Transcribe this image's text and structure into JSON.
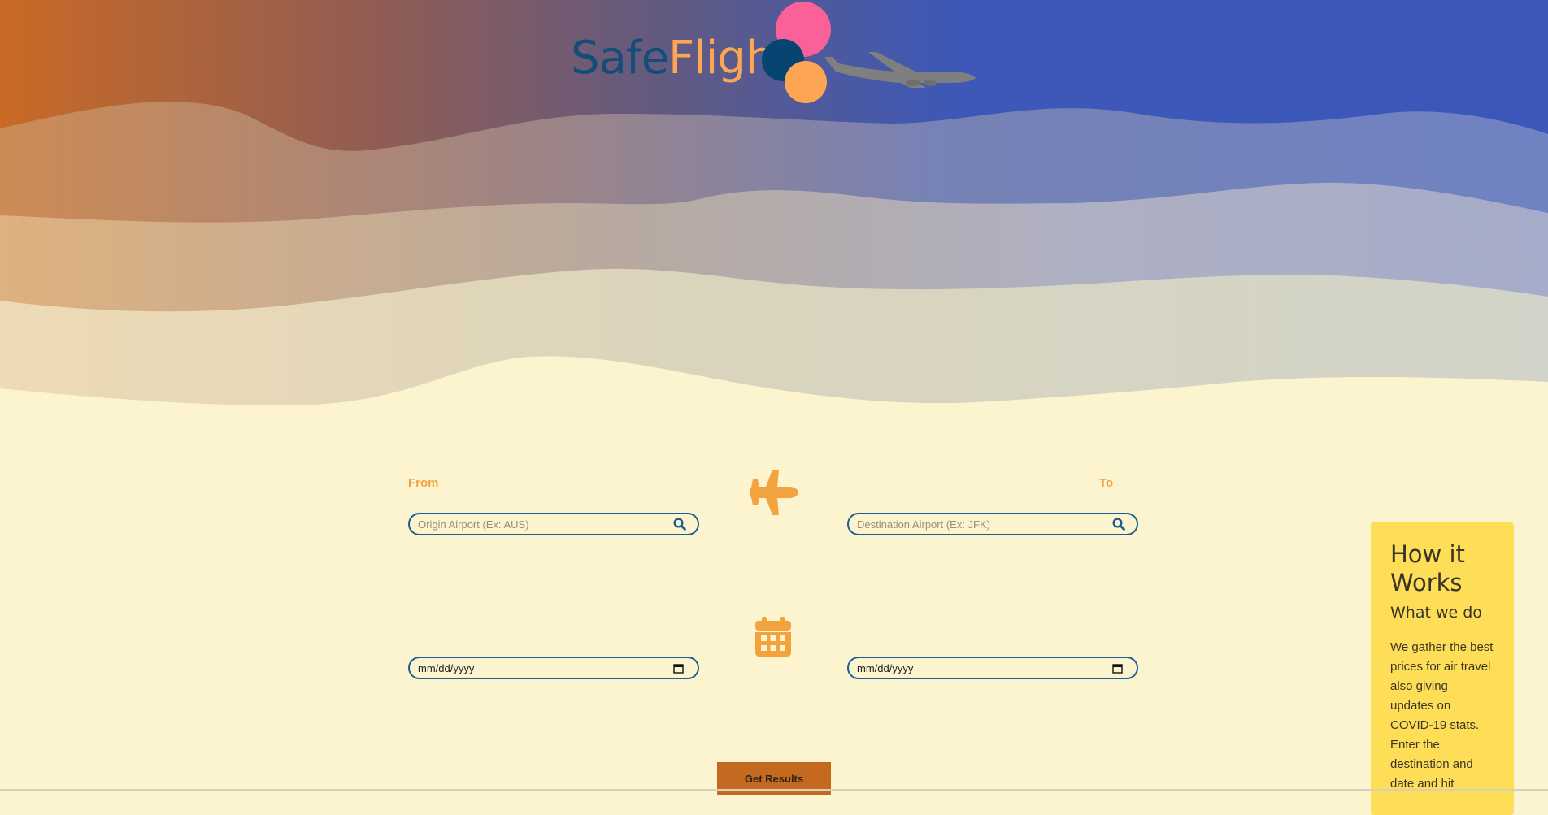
{
  "brand": {
    "name_part1": "Safe",
    "name_part2": "Flight",
    "colors": {
      "navy": "#164c78",
      "orange": "#fca653",
      "pink": "#fa6198"
    }
  },
  "search": {
    "from_label": "From",
    "to_label": "To",
    "origin_placeholder": "Origin Airport (Ex: AUS)",
    "destination_placeholder": "Destination Airport (Ex: JFK)",
    "depart_date_value": "mm/dd/yyyy",
    "return_date_value": "mm/dd/yyyy",
    "icons": {
      "search": "search-icon",
      "flight": "airplane-icon",
      "date": "calendar-icon"
    }
  },
  "actions": {
    "submit_label": "Get Results"
  },
  "how_it_works": {
    "title": "How it Works",
    "subtitle": "What we do",
    "body": "We gather the best prices for air travel also giving updates on COVID-19 stats. Enter the destination and date and hit"
  },
  "theme": {
    "background": "#fcf4cf",
    "accent": "#f2a33e",
    "button": "#c4691f",
    "card": "#fedd57"
  }
}
